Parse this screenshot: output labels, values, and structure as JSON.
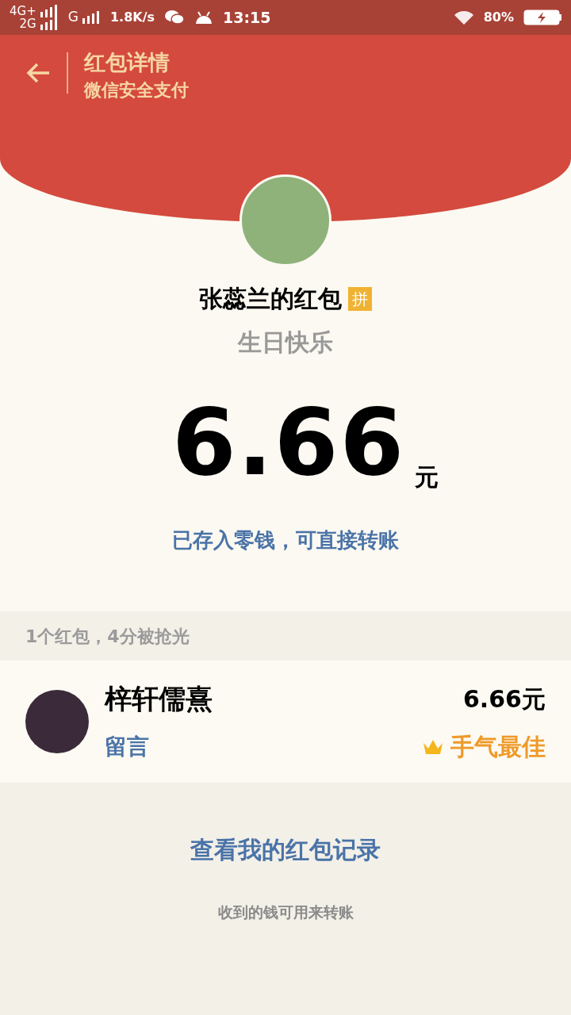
{
  "status_bar": {
    "network_top": "4G+",
    "network_bottom": "2G",
    "network_extra": "G",
    "speed": "1.8K/s",
    "time": "13:15",
    "battery": "80%"
  },
  "header": {
    "title": "红包详情",
    "subtitle": "微信安全支付"
  },
  "packet": {
    "sender_title": "张蕊兰的红包",
    "badge": "拼",
    "greeting": "生日快乐",
    "amount": "6.66",
    "unit": "元",
    "note": "已存入零钱，可直接转账"
  },
  "summary": "1个红包，4分被抢光",
  "recipients": [
    {
      "name": "梓轩儒熹",
      "amount": "6.66元",
      "message_label": "留言",
      "best_luck": true,
      "best_label": "手气最佳"
    }
  ],
  "footer": {
    "link": "查看我的红包记录",
    "note": "收到的钱可用来转账"
  }
}
